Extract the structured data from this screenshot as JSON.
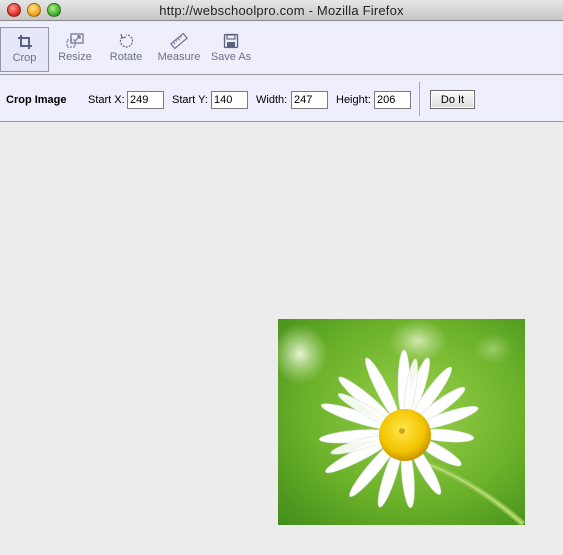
{
  "window": {
    "title": "http://webschoolpro.com - Mozilla Firefox"
  },
  "toolbar": {
    "tools": [
      {
        "label": "Crop",
        "icon": "crop-icon",
        "active": true
      },
      {
        "label": "Resize",
        "icon": "resize-icon",
        "active": false
      },
      {
        "label": "Rotate",
        "icon": "rotate-icon",
        "active": false
      },
      {
        "label": "Measure",
        "icon": "ruler-icon",
        "active": false
      },
      {
        "label": "Save As",
        "icon": "floppy-disk-icon",
        "active": false
      }
    ]
  },
  "crop_panel": {
    "heading": "Crop Image",
    "start_x_label": "Start X:",
    "start_x": "249",
    "start_y_label": "Start Y:",
    "start_y": "140",
    "width_label": "Width:",
    "width": "247",
    "height_label": "Height:",
    "height": "206",
    "submit_label": "Do It"
  },
  "canvas": {
    "image_subject": "white daisy flower with yellow center on green background",
    "colors": {
      "background": "#ececec",
      "toolbar": "#eeeefd"
    }
  }
}
